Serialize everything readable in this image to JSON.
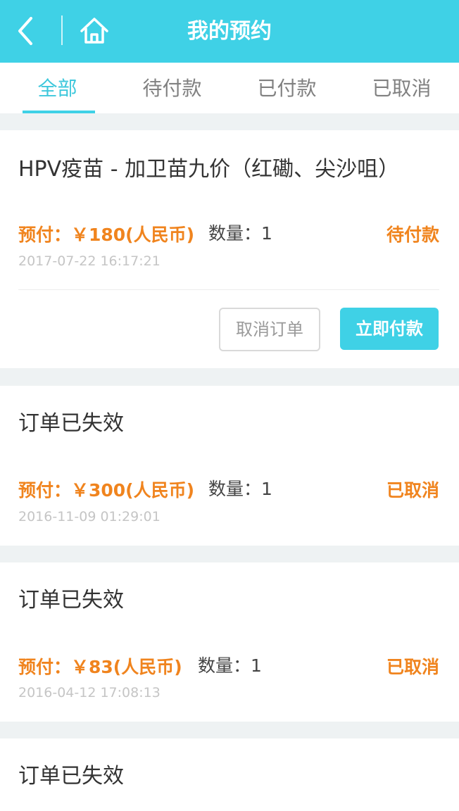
{
  "colors": {
    "header_bg": "#3fd1e6",
    "accent": "#3fd1e6",
    "price": "#f0841e",
    "background": "#eef2f3"
  },
  "header": {
    "title": "我的预约",
    "back_icon": "chevron-left-icon",
    "home_icon": "home-icon"
  },
  "tabs": [
    {
      "label": "全部",
      "active": true
    },
    {
      "label": "待付款",
      "active": false
    },
    {
      "label": "已付款",
      "active": false
    },
    {
      "label": "已取消",
      "active": false
    }
  ],
  "orders": [
    {
      "title": "HPV疫苗 - 加卫苗九价（红磡、尖沙咀）",
      "price": "预付：￥180(人民币)",
      "quantity": "数量：1",
      "status": "待付款",
      "time": "2017-07-22 16:17:21",
      "actions": {
        "cancel": "取消订单",
        "pay": "立即付款"
      }
    },
    {
      "title": "订单已失效",
      "price": "预付：￥300(人民币)",
      "quantity": "数量：1",
      "status": "已取消",
      "time": "2016-11-09 01:29:01"
    },
    {
      "title": "订单已失效",
      "price": "预付：￥83(人民币)",
      "quantity": "数量：1",
      "status": "已取消",
      "time": "2016-04-12 17:08:13"
    },
    {
      "title": "订单已失效"
    }
  ]
}
